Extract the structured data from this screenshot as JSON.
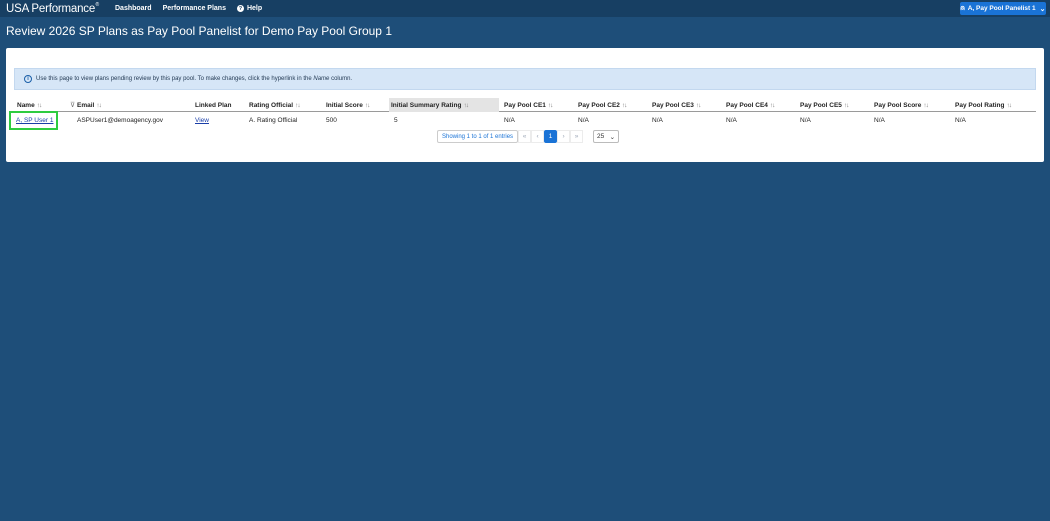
{
  "app": {
    "brand": "USA Performance",
    "brand_mark": "®"
  },
  "nav": {
    "dashboard": "Dashboard",
    "performance_plans": "Performance Plans",
    "help": "Help"
  },
  "user_menu": {
    "label": "A, Pay Pool Panelist 1"
  },
  "page": {
    "title": "Review 2026 SP Plans as Pay Pool Panelist for Demo Pay Pool Group 1"
  },
  "info_banner": {
    "text_before": "Use this page to view plans pending review by this pay pool. To make changes, click the hyperlink in the ",
    "emphasis": "Name",
    "text_after": " column."
  },
  "table": {
    "columns": [
      "Name",
      "Email",
      "Linked Plan",
      "Rating Official",
      "Initial Score",
      "Initial Summary Rating",
      "Pay Pool CE1",
      "Pay Pool CE2",
      "Pay Pool CE3",
      "Pay Pool CE4",
      "Pay Pool CE5",
      "Pay Pool Score",
      "Pay Pool Rating"
    ],
    "sort_glyph": "↑↓",
    "rows": [
      [
        "A, SP User 1",
        "ASPUser1@demoagency.gov",
        "View",
        "A. Rating Official",
        "500",
        "5",
        "N/A",
        "N/A",
        "N/A",
        "N/A",
        "N/A",
        "N/A",
        "N/A"
      ]
    ]
  },
  "pager": {
    "info": "Showing 1 to 1 of 1 entries",
    "first": "«",
    "prev": "‹",
    "current": "1",
    "next": "›",
    "last": "»",
    "page_size": "25"
  },
  "colors": {
    "background": "#1e4e79",
    "topbar": "#173f63",
    "accent": "#1a73d6",
    "highlight": "#2ecc40"
  }
}
